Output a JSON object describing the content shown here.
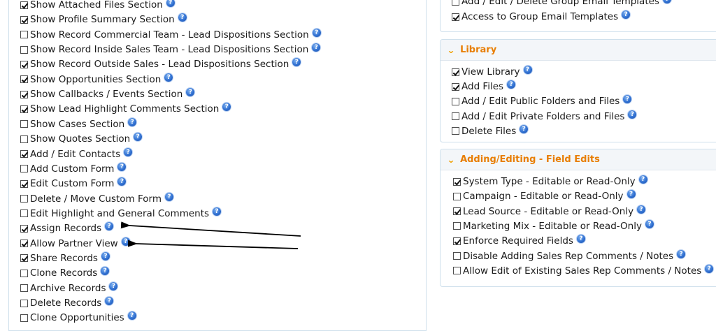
{
  "left_permissions": [
    {
      "label": "Show Attached Files Section",
      "checked": true
    },
    {
      "label": "Show Profile Summary Section",
      "checked": true
    },
    {
      "label": "Show Record Commercial Team - Lead Dispositions Section",
      "checked": false
    },
    {
      "label": "Show Record Inside Sales Team - Lead Dispositions Section",
      "checked": false
    },
    {
      "label": "Show Record Outside Sales - Lead Dispositions Section",
      "checked": true
    },
    {
      "label": "Show Opportunities Section",
      "checked": true
    },
    {
      "label": "Show Callbacks / Events Section",
      "checked": true
    },
    {
      "label": "Show Lead Highlight Comments Section",
      "checked": true
    },
    {
      "label": "Show Cases Section",
      "checked": false
    },
    {
      "label": "Show Quotes Section",
      "checked": false
    },
    {
      "label": "Add / Edit Contacts",
      "checked": true
    },
    {
      "label": "Add Custom Form",
      "checked": false
    },
    {
      "label": "Edit Custom Form",
      "checked": true
    },
    {
      "label": "Delete / Move Custom Form",
      "checked": false
    },
    {
      "label": "Edit Highlight and General Comments",
      "checked": false
    },
    {
      "label": "Assign Records",
      "checked": true
    },
    {
      "label": "Allow Partner View",
      "checked": true
    },
    {
      "label": "Share Records",
      "checked": true
    },
    {
      "label": "Clone Records",
      "checked": false
    },
    {
      "label": "Archive Records",
      "checked": false
    },
    {
      "label": "Delete Records",
      "checked": false
    },
    {
      "label": "Clone Opportunities",
      "checked": false
    }
  ],
  "email_templates": [
    {
      "label": "Add / Edit / Delete Group Email Templates",
      "checked": false
    },
    {
      "label": "Access to Group Email Templates",
      "checked": true
    }
  ],
  "library": {
    "title": "Library",
    "items": [
      {
        "label": "View Library",
        "checked": true
      },
      {
        "label": "Add Files",
        "checked": true
      },
      {
        "label": "Add / Edit Public Folders and Files",
        "checked": false
      },
      {
        "label": "Add / Edit Private Folders and Files",
        "checked": false
      },
      {
        "label": "Delete Files",
        "checked": false
      }
    ]
  },
  "field_edits": {
    "title": "Adding/Editing - Field Edits",
    "items": [
      {
        "label": "System Type - Editable or Read-Only",
        "checked": true
      },
      {
        "label": "Campaign - Editable or Read-Only",
        "checked": false
      },
      {
        "label": "Lead Source - Editable or Read-Only",
        "checked": true
      },
      {
        "label": "Marketing Mix - Editable or Read-Only",
        "checked": false
      },
      {
        "label": "Enforce Required Fields",
        "checked": true
      },
      {
        "label": "Disable Adding Sales Rep Comments / Notes",
        "checked": false
      },
      {
        "label": "Allow Edit of Existing Sales Rep Comments / Notes",
        "checked": false
      }
    ]
  },
  "help_glyph": "?",
  "icons": {
    "help": "help-circle-icon",
    "chevron": "chevron-down-icon"
  },
  "colors": {
    "section_title": "#e87e04",
    "chevron": "#f0a000",
    "help_icon": "#2f6fd1",
    "border": "#cfe0ec"
  }
}
